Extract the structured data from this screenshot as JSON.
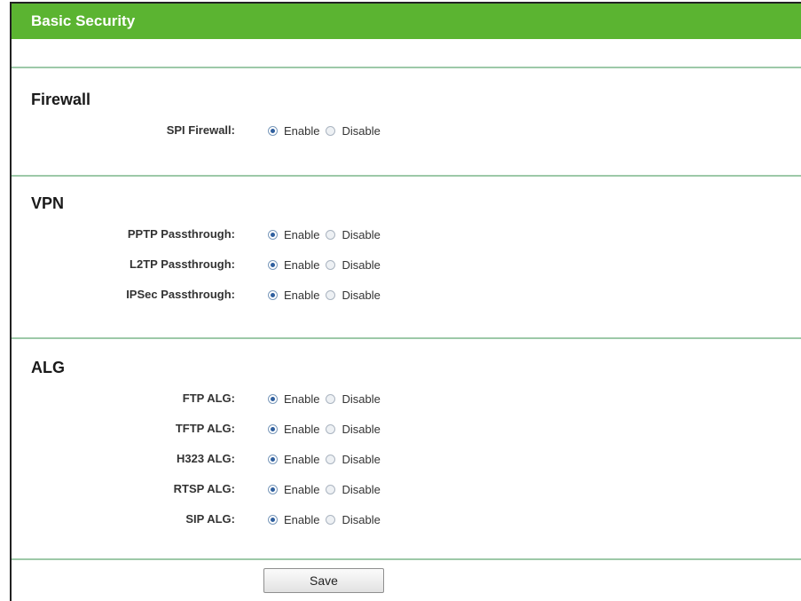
{
  "header": {
    "title": "Basic Security"
  },
  "firewall": {
    "title": "Firewall",
    "rows": [
      {
        "label": "SPI Firewall:",
        "selected": "Enable"
      }
    ]
  },
  "vpn": {
    "title": "VPN",
    "rows": [
      {
        "label": "PPTP Passthrough:",
        "selected": "Enable"
      },
      {
        "label": "L2TP Passthrough:",
        "selected": "Enable"
      },
      {
        "label": "IPSec Passthrough:",
        "selected": "Enable"
      }
    ]
  },
  "alg": {
    "title": "ALG",
    "rows": [
      {
        "label": "FTP ALG:",
        "selected": "Enable"
      },
      {
        "label": "TFTP ALG:",
        "selected": "Enable"
      },
      {
        "label": "H323 ALG:",
        "selected": "Enable"
      },
      {
        "label": "RTSP ALG:",
        "selected": "Enable"
      },
      {
        "label": "SIP ALG:",
        "selected": "Enable"
      }
    ]
  },
  "options": {
    "enable": "Enable",
    "disable": "Disable"
  },
  "actions": {
    "save_label": "Save"
  },
  "colors": {
    "header_bg": "#5bb431",
    "divider": "#9dc9a8",
    "header_text": "#ffffff"
  }
}
